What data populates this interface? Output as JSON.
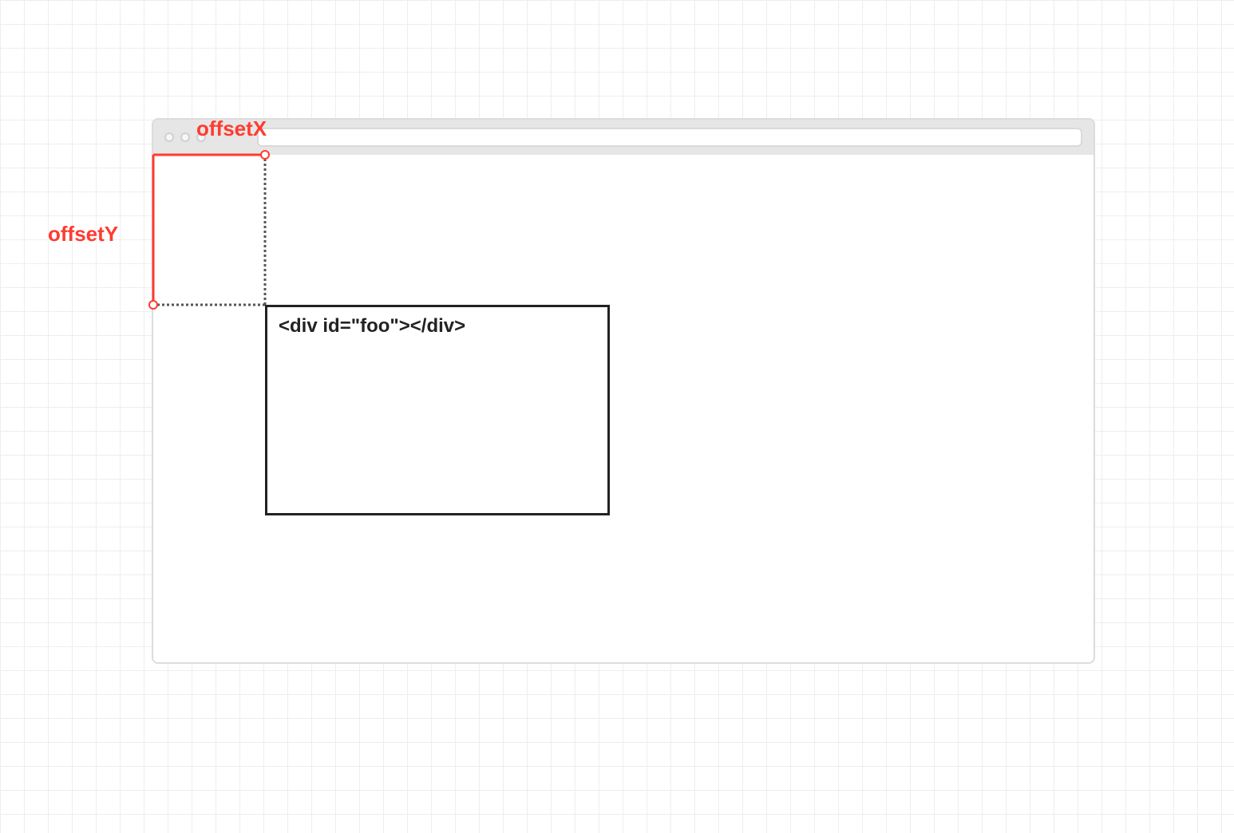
{
  "labels": {
    "offset_x": "offsetX",
    "offset_y": "offsetY"
  },
  "target_element_code": "<div id=\"foo\"></div>",
  "colors": {
    "accent_red": "#ff3b30",
    "box_border": "#222222",
    "chrome_gray": "#e6e6e6",
    "grid_line": "#eeeeee"
  }
}
